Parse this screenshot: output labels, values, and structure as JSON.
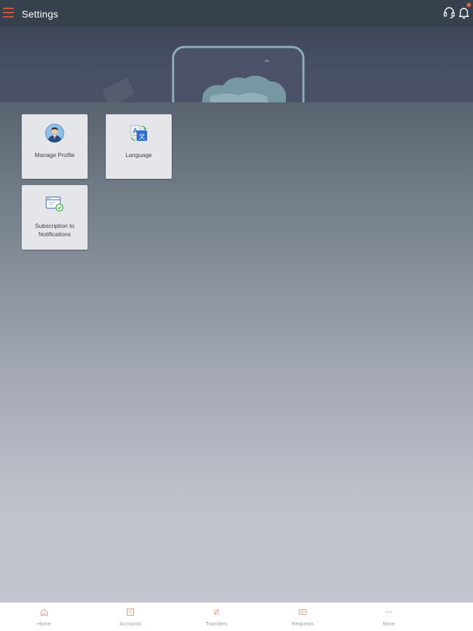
{
  "header": {
    "title": "Settings",
    "menu_icon": "hamburger-menu-icon",
    "support_icon": "headset-icon",
    "notifications_icon": "bell-icon",
    "accent_color": "#c9573f",
    "badge_color": "#e1663f"
  },
  "tiles": [
    {
      "label": "Manage Profile",
      "icon": "user-avatar-icon"
    },
    {
      "label": "Language",
      "icon": "translate-icon"
    },
    {
      "label": "Subscription to Notifications",
      "icon": "notification-subscription-icon"
    }
  ],
  "bottom_nav": [
    {
      "label": "Home",
      "icon": "home-icon"
    },
    {
      "label": "Accounts",
      "icon": "accounts-icon"
    },
    {
      "label": "Transfers",
      "icon": "transfers-icon"
    },
    {
      "label": "Requests",
      "icon": "requests-icon"
    },
    {
      "label": "More",
      "icon": "more-icon"
    }
  ]
}
